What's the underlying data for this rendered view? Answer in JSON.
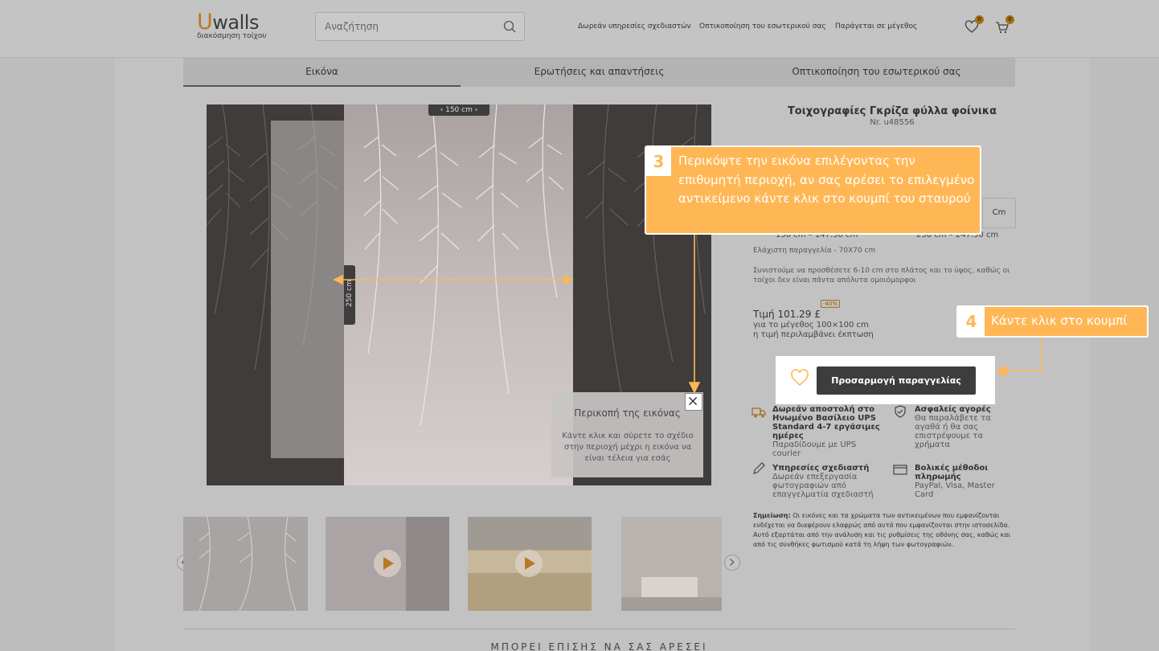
{
  "header": {
    "logo_main_u": "U",
    "logo_main_rest": "walls",
    "logo_sub": "διακόσμηση τοίχου",
    "search_placeholder": "Αναζήτηση",
    "nav": [
      "Δωρεάν υπηρεσίες σχεδιαστών",
      "Οπτικοποίηση του εσωτερικού σας",
      "Παράγεται σε μέγεθος"
    ],
    "wishlist_count": "0",
    "cart_count": "0"
  },
  "tabs": [
    "Εικόνα",
    "Ερωτήσεις και απαντήσεις",
    "Οπτικοποίηση του εσωτερικού σας"
  ],
  "image": {
    "width_label": "150 cm",
    "height_label": "250 cm"
  },
  "crop_popup": {
    "title": "Περικοπή της εικόνας",
    "text": "Κάντε κλικ και σύρετε το σχέδιο στην περιοχή μέχρι η εικόνα να είναι τέλεια για εσάς"
  },
  "product": {
    "title": "Τοιχογραφίες Γκρίζα φύλλα φοίνικα",
    "code": "Nr. u48556",
    "unit": "Cm",
    "size_left": "150 cm – 147.50 cm",
    "size_right": "250 cm – 247.50 cm",
    "min_order": "Ελάχιστη παραγγελία - 70X70 cm",
    "recommend": "Συνιστούμε να προσθέσετε 6-10 cm στο πλάτος και το ύψος, καθώς οι τοίχοι δεν είναι πάντα απόλυτα ομοιόμορφοι",
    "price": "Τιμή 101.29 £",
    "discount": "-40%",
    "price_size": "για το μέγεθος 100×100 cm",
    "price_note": "η τιμή περιλαμβάνει έκπτωση",
    "order_button": "Προσαρμογή παραγγελίας"
  },
  "features": [
    {
      "title": "Δωρεάν αποστολή στο Ηνωμένο Βασίλειο UPS Standard 4-7 εργάσιμες ημέρες",
      "sub": "Παραδίδουμε με UPS courier",
      "icon": "truck-icon"
    },
    {
      "title": "Ασφαλείς αγορές",
      "sub": "Θα παραλάβετε τα αγαθά ή θα σας επιστρέψουμε τα χρήματα",
      "icon": "shield-icon"
    },
    {
      "title": "Υπηρεσίες σχεδιαστή",
      "sub": "Δωρεάν επεξεργασία φωτογραφιών από επαγγελματία σχεδιαστή",
      "icon": "pencil-icon"
    },
    {
      "title": "Βολικές μέθοδοι πληρωμής",
      "sub": "PayPal, Visa, Master Card",
      "icon": "wallet-icon"
    }
  ],
  "note": {
    "label": "Σημείωση:",
    "text": " Οι εικόνες και τα χρώματα των αντικειμένων που εμφανίζονται ενδέχεται να διαφέρουν ελαφρώς από αυτά που εμφανίζονται στην ιστοσελίδα. Αυτό εξαρτάται από την ανάλυση και τις ρυθμίσεις της οθόνης σας, καθώς και από τις συνθήκες φωτισμού κατά τη λήψη των φωτογραφιών."
  },
  "also_like": "ΜΠΟΡΕΙ ΕΠΙΣΗΣ ΝΑ ΣΑΣ ΑΡΕΣΕΙ",
  "tutorial": {
    "step3_num": "3",
    "step3_text": "Περικόψτε την εικόνα επιλέγοντας την επιθυμητή περιοχή, αν σας αρέσει το επιλεγμένο αντικείμενο κάντε κλικ στο κουμπί του σταυρού",
    "step4_num": "4",
    "step4_text": "Κάντε κλικ στο κουμπί"
  },
  "colors": {
    "accent": "#ffb755",
    "brand": "#b97a1e",
    "button": "#3d3d3d"
  }
}
